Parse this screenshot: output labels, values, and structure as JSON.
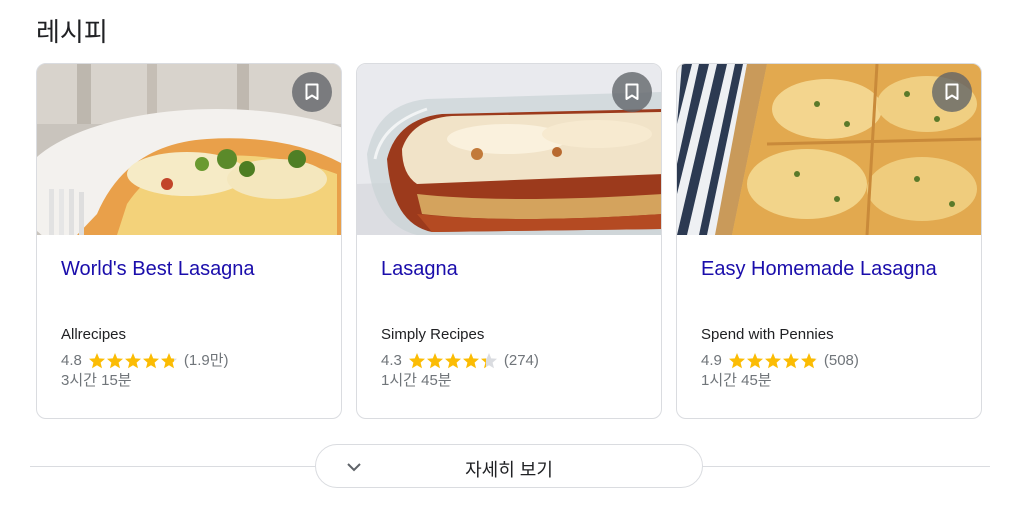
{
  "section": {
    "title": "레시피"
  },
  "recipes": [
    {
      "title": "World's Best Lasagna",
      "source": "Allrecipes",
      "rating": "4.8",
      "stars": 4.8,
      "count": "(1.9만)",
      "time": "3시간 15분"
    },
    {
      "title": "Lasagna",
      "source": "Simply Recipes",
      "rating": "4.3",
      "stars": 4.3,
      "count": "(274)",
      "time": "1시간 45분"
    },
    {
      "title": "Easy Homemade Lasagna",
      "source": "Spend with Pennies",
      "rating": "4.9",
      "stars": 4.9,
      "count": "(508)",
      "time": "1시간 45분"
    }
  ],
  "more": {
    "label": "자세히 보기"
  },
  "colors": {
    "link": "#1a0dab",
    "star": "#fbbc04",
    "muted": "#70757a"
  },
  "icons": {
    "bookmark": "bookmark-icon",
    "chevron": "chevron-down-icon",
    "star": "star-icon"
  }
}
